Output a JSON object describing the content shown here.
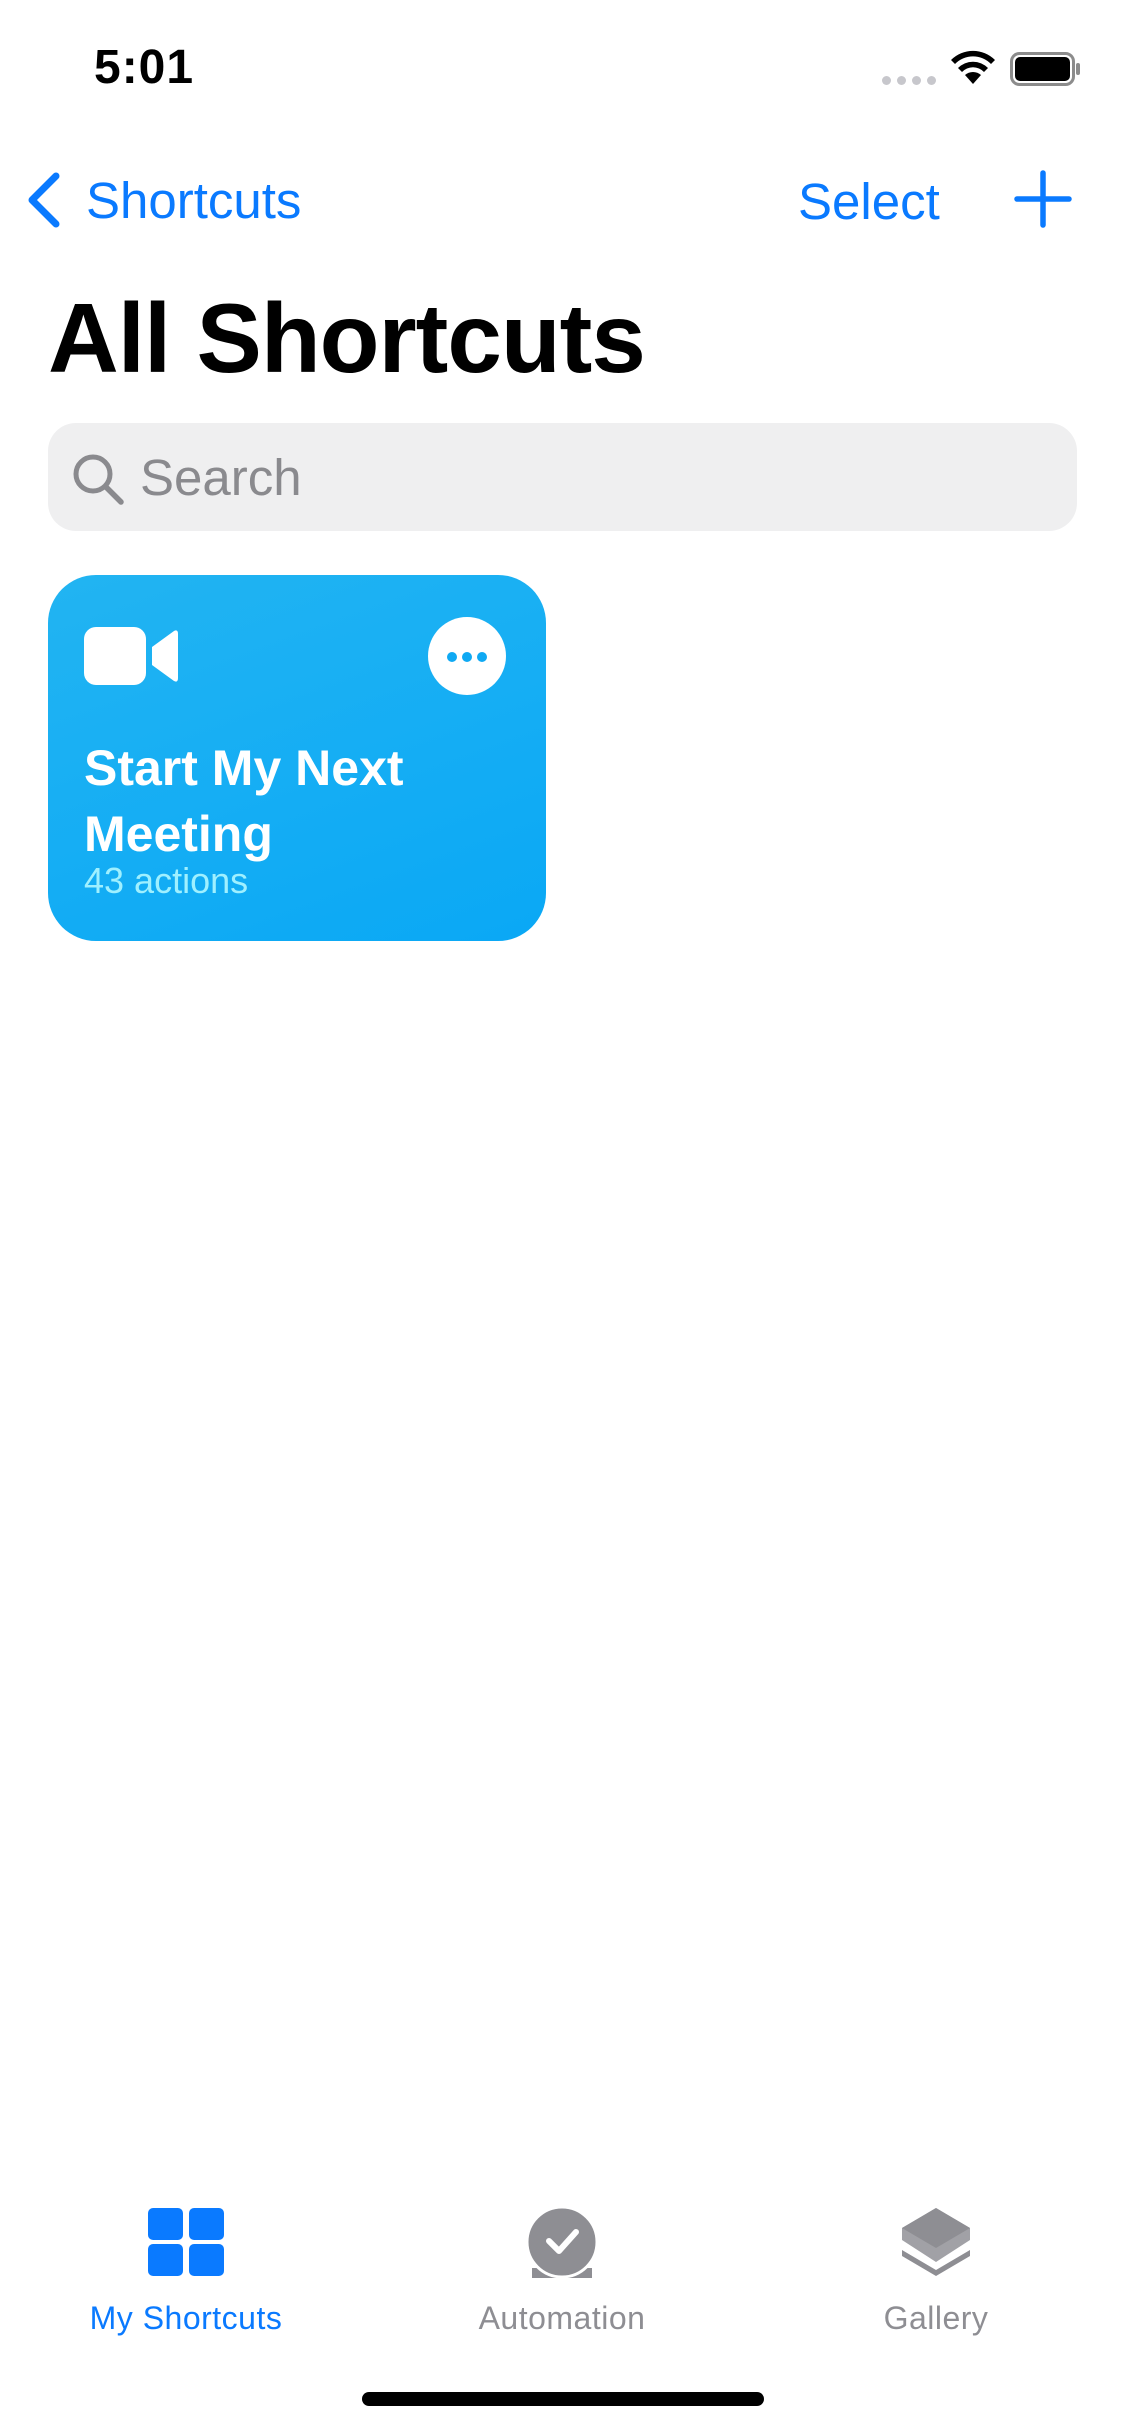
{
  "status_bar": {
    "time": "5:01"
  },
  "nav": {
    "back_label": "Shortcuts",
    "select_label": "Select",
    "add_icon": "plus-icon",
    "back_icon": "chevron-left-icon"
  },
  "page_title": "All Shortcuts",
  "search": {
    "placeholder": "Search",
    "value": ""
  },
  "shortcuts": [
    {
      "title": "Start My Next Meeting",
      "subtitle": "43 actions",
      "icon": "video-camera-icon",
      "color": "#18aef3"
    }
  ],
  "tab_bar": {
    "tabs": [
      {
        "label": "My Shortcuts",
        "icon": "grid-icon",
        "active": true
      },
      {
        "label": "Automation",
        "icon": "checkmark-clock-icon",
        "active": false
      },
      {
        "label": "Gallery",
        "icon": "layers-icon",
        "active": false
      }
    ]
  },
  "colors": {
    "accent": "#0a7aff",
    "inactive_tab": "#8e8e93",
    "search_bg": "#efeff0",
    "card_bg": "#18aef3"
  }
}
